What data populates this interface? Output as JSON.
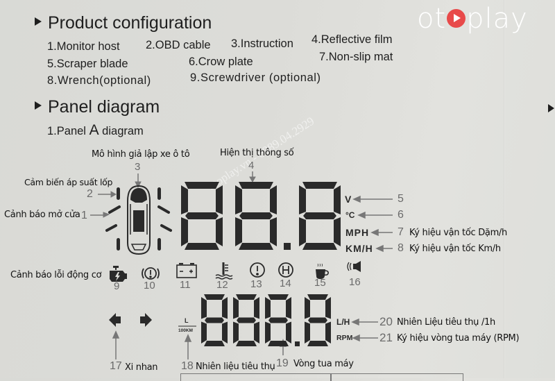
{
  "brand": {
    "logo_left": "ot",
    "logo_right": "play",
    "watermark": "otoplay.vn - 0989.04.2929",
    "accent": "#e84a4a"
  },
  "sections": {
    "product_configuration": {
      "title": "Product configuration",
      "items": [
        "1.Monitor host",
        "2.OBD cable",
        "3.Instruction",
        "4.Reflective film",
        "5.Scraper blade",
        "6.Crow plate",
        "7.Non-slip mat",
        "8.Wrench(optional)",
        "9.Screwdriver (optional)"
      ]
    },
    "panel_diagram": {
      "title": "Panel diagram",
      "subtitle_prefix": "1.Panel",
      "subtitle_letter": "A",
      "subtitle_suffix": "diagram"
    }
  },
  "diagram": {
    "callouts": {
      "c1": {
        "num": "1",
        "label": "Cảnh báo mở cửa"
      },
      "c2": {
        "num": "2",
        "label": "Cảm biến áp suất lốp"
      },
      "c3": {
        "num": "3",
        "label": "Mô hình giả lập xe ô tô"
      },
      "c4": {
        "num": "4",
        "label": "Hiện thị thông số"
      },
      "c5": {
        "num": "5",
        "unit": "V"
      },
      "c6": {
        "num": "6",
        "unit": "°C"
      },
      "c7": {
        "num": "7",
        "unit": "MPH",
        "label": "Ký hiệu vận tốc Dặm/h"
      },
      "c8": {
        "num": "8",
        "unit": "KM/H",
        "label": "Ký hiệu vận tốc Km/h"
      },
      "c9": {
        "num": "9",
        "label": "Cảnh báo lỗi động cơ"
      },
      "c10": {
        "num": "10"
      },
      "c11": {
        "num": "11"
      },
      "c12": {
        "num": "12"
      },
      "c13": {
        "num": "13"
      },
      "c14": {
        "num": "14"
      },
      "c15": {
        "num": "15"
      },
      "c16": {
        "num": "16"
      },
      "c17": {
        "num": "17",
        "label": "Xi nhan"
      },
      "c18": {
        "num": "18",
        "label": "Nhiên liệu tiêu thụ",
        "unit_top": "L",
        "unit_bottom": "100KM"
      },
      "c19": {
        "num": "19",
        "label": "Vòng tua máy"
      },
      "c20": {
        "num": "20",
        "unit": "L/H",
        "label": "Nhiên Liệu tiêu thụ /1h"
      },
      "c21": {
        "num": "21",
        "unit": "RPM",
        "label": "Ký hiệu vòng tua máy (RPM)"
      }
    },
    "speed_display": "88.8",
    "rpm_display": "888.8"
  }
}
